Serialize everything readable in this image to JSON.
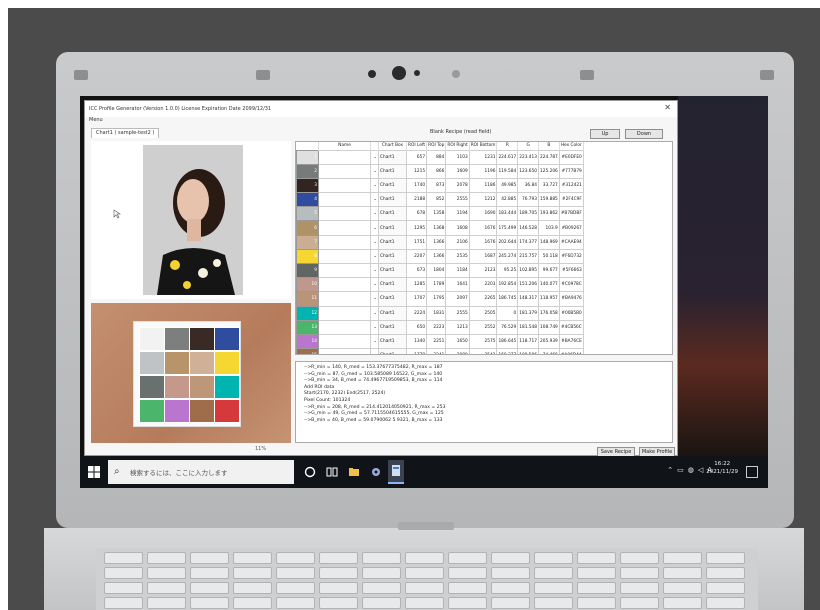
{
  "window": {
    "title": "ICC Profile Generator (Version 1.0.0) License Expiration Date 2099/12/31",
    "close_glyph": "✕",
    "menu": "Menu",
    "tab": "Chart1 ( sample-test2 )",
    "list_title": "Blank Recipe (read field)",
    "up_button": "Up",
    "down_button": "Down",
    "save_button": "Save Recipe",
    "make_button": "Make Profile",
    "zoom_label": "11%"
  },
  "grid": {
    "headers": [
      "",
      "Name",
      "",
      "Chart Box",
      "ROI Left",
      "ROI Top",
      "ROI Right",
      "ROI Bottom",
      "R",
      "G",
      "B",
      "Hex Color"
    ],
    "rows": [
      {
        "no": "1",
        "chart": "Chart1",
        "left": "657",
        "top": "884",
        "right": "1103",
        "bottom": "1231",
        "r": "224.617",
        "g": "223.413",
        "b": "224.787",
        "hex": "#E0DFE0",
        "swatch": "#e0dfe0"
      },
      {
        "no": "2",
        "chart": "Chart1",
        "left": "1215",
        "top": "866",
        "right": "1609",
        "bottom": "1196",
        "r": "119.584",
        "g": "123.650",
        "b": "125.206",
        "hex": "#777B79",
        "swatch": "#777b79"
      },
      {
        "no": "3",
        "chart": "Chart1",
        "left": "1740",
        "top": "873",
        "right": "2078",
        "bottom": "1186",
        "r": "49.985",
        "g": "36.84",
        "b": "33.727",
        "hex": "#312421",
        "swatch": "#312421"
      },
      {
        "no": "4",
        "chart": "Chart1",
        "left": "2188",
        "top": "852",
        "right": "2555",
        "bottom": "1212",
        "r": "42.885",
        "g": "76.793",
        "b": "159.885",
        "hex": "#2F4C9F",
        "swatch": "#2f4c9f"
      },
      {
        "no": "5",
        "chart": "Chart1",
        "left": "678",
        "top": "1358",
        "right": "1194",
        "bottom": "1690",
        "r": "183.444",
        "g": "189.705",
        "b": "193.862",
        "hex": "#B7BDBF",
        "swatch": "#b7bdbf"
      },
      {
        "no": "6",
        "chart": "Chart1",
        "left": "1295",
        "top": "1368",
        "right": "1608",
        "bottom": "1676",
        "r": "175.499",
        "g": "146.528",
        "b": "103.9",
        "hex": "#B09267",
        "swatch": "#b09267"
      },
      {
        "no": "7",
        "chart": "Chart1",
        "left": "1751",
        "top": "1366",
        "right": "2106",
        "bottom": "1676",
        "r": "202.644",
        "g": "174.377",
        "b": "148.969",
        "hex": "#CAAE94",
        "swatch": "#caae94"
      },
      {
        "no": "8",
        "chart": "Chart1",
        "left": "2207",
        "top": "1366",
        "right": "2535",
        "bottom": "1687",
        "r": "245.274",
        "g": "215.757",
        "b": "50.118",
        "hex": "#F6D732",
        "swatch": "#f6d732"
      },
      {
        "no": "9",
        "chart": "Chart1",
        "left": "673",
        "top": "1804",
        "right": "1184",
        "bottom": "2123",
        "r": "95.25",
        "g": "102.895",
        "b": "99.677",
        "hex": "#5F6663",
        "swatch": "#5f6663"
      },
      {
        "no": "10",
        "chart": "Chart1",
        "left": "1285",
        "top": "1789",
        "right": "1641",
        "bottom": "2203",
        "r": "192.854",
        "g": "151.206",
        "b": "140.077",
        "hex": "#C0978C",
        "swatch": "#c0978c"
      },
      {
        "no": "11",
        "chart": "Chart1",
        "left": "1707",
        "top": "1795",
        "right": "2097",
        "bottom": "2265",
        "r": "186.745",
        "g": "148.317",
        "b": "118.957",
        "hex": "#BA9476",
        "swatch": "#ba9476"
      },
      {
        "no": "12",
        "chart": "Chart1",
        "left": "2224",
        "top": "1831",
        "right": "2555",
        "bottom": "2505",
        "r": "0",
        "g": "181.379",
        "b": "176.058",
        "hex": "#00B5B0",
        "swatch": "#00b5b0"
      },
      {
        "no": "13",
        "chart": "Chart1",
        "left": "650",
        "top": "2223",
        "right": "1213",
        "bottom": "2552",
        "r": "76.529",
        "g": "181.548",
        "b": "108.749",
        "hex": "#4CB56C",
        "swatch": "#4cb56c"
      },
      {
        "no": "14",
        "chart": "Chart1",
        "left": "1340",
        "top": "2251",
        "right": "1650",
        "bottom": "2575",
        "r": "186.645",
        "g": "118.717",
        "b": "205.939",
        "hex": "#BA76CE",
        "swatch": "#ba76ce"
      },
      {
        "no": "15",
        "chart": "Chart1",
        "left": "1778",
        "top": "2241",
        "right": "2089",
        "bottom": "2542",
        "r": "160.377",
        "g": "109.586",
        "b": "74.466",
        "hex": "#A06D4A",
        "swatch": "#a06d4a"
      },
      {
        "no": "16",
        "chart": "Chart1",
        "left": "2170",
        "top": "2232",
        "right": "2517",
        "bottom": "2524",
        "r": "214.412",
        "g": "57.712",
        "b": "59.079",
        "hex": "#D6393B",
        "swatch": "#d6393b"
      }
    ]
  },
  "log": [
    "-->R_min = 140, R_med = 153.37677375482, R_max = 187",
    "-->G_min = 87, G_med = 103.585089 16522, G_max = 140",
    "-->B_min = 34, B_med = 74.4967719509853, B_max = 114",
    "Add ROI data",
    "Start(2170, 2232) End(2517, 2524)",
    "Pixel Count: 101324",
    "-->R_min = 208, R_med = 214.412014050921, R_max = 253",
    "-->G_min = 49, G_med = 57.7115504615555, G_max = 125",
    "-->B_min = 40, B_med = 59.0790062 5 9321, B_max = 133"
  ],
  "taskbar": {
    "search_placeholder": "検索するには、ここに入力します",
    "ime": "A",
    "time": "16:22",
    "date": "2021/11/29"
  },
  "chart_patches": [
    "#f2f2f2",
    "#7c7f7d",
    "#3a2a26",
    "#2f4c9f",
    "#bfc3c5",
    "#b7946a",
    "#d0b096",
    "#f6d732",
    "#6a706d",
    "#c4998c",
    "#be9678",
    "#00b5b0",
    "#4cb56c",
    "#ba76ce",
    "#a06d4a",
    "#d6393b"
  ],
  "icons": [
    "windows-start-icon",
    "search-icon",
    "cortana-icon",
    "task-view-icon",
    "file-explorer-icon",
    "settings-icon",
    "app-icon",
    "chevron-up-icon",
    "battery-icon",
    "network-icon",
    "volume-icon",
    "notification-icon",
    "mouse-cursor-icon"
  ]
}
